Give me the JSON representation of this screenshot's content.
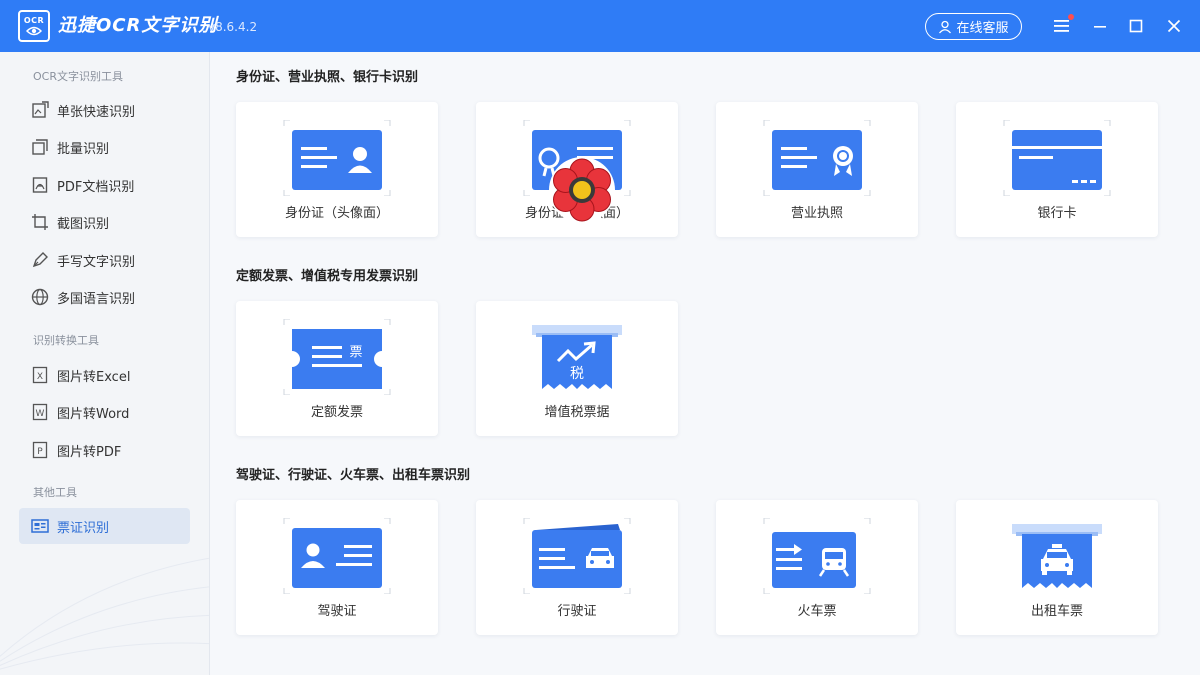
{
  "app": {
    "logo_text": "OCR",
    "title": "迅捷OCR文字识别",
    "version": "v8.6.4.2",
    "service_label": "在线客服"
  },
  "colors": {
    "primary": "#2f7cf6",
    "accent_blue": "#3b7cf0",
    "active_bg": "#dfe7f3"
  },
  "sidebar": {
    "sections": [
      {
        "title": "OCR文字识别工具",
        "items": [
          {
            "label": "单张快速识别",
            "icon": "single-image-icon"
          },
          {
            "label": "批量识别",
            "icon": "batch-icon"
          },
          {
            "label": "PDF文档识别",
            "icon": "pdf-icon"
          },
          {
            "label": "截图识别",
            "icon": "crop-icon"
          },
          {
            "label": "手写文字识别",
            "icon": "pen-icon"
          },
          {
            "label": "多国语言识别",
            "icon": "globe-icon"
          }
        ]
      },
      {
        "title": "识别转换工具",
        "items": [
          {
            "label": "图片转Excel",
            "icon": "excel-icon",
            "letter": "X"
          },
          {
            "label": "图片转Word",
            "icon": "word-icon",
            "letter": "W"
          },
          {
            "label": "图片转PDF",
            "icon": "pdf-file-icon",
            "letter": "P"
          }
        ]
      },
      {
        "title": "其他工具",
        "items": [
          {
            "label": "票证识别",
            "icon": "ticket-icon",
            "active": true
          }
        ]
      }
    ]
  },
  "main": {
    "sections": [
      {
        "title": "身份证、营业执照、银行卡识别",
        "cards": [
          {
            "label": "身份证（头像面）",
            "icon": "id-card-front-icon"
          },
          {
            "label": "身份证（国徽面）",
            "icon": "id-card-back-icon"
          },
          {
            "label": "营业执照",
            "icon": "business-license-icon"
          },
          {
            "label": "银行卡",
            "icon": "bank-card-icon"
          }
        ]
      },
      {
        "title": "定额发票、增值税专用发票识别",
        "cards": [
          {
            "label": "定额发票",
            "icon": "fixed-invoice-icon",
            "glyph": "票"
          },
          {
            "label": "增值税票据",
            "icon": "vat-invoice-icon",
            "glyph": "税"
          }
        ]
      },
      {
        "title": "驾驶证、行驶证、火车票、出租车票识别",
        "cards": [
          {
            "label": "驾驶证",
            "icon": "driver-license-icon"
          },
          {
            "label": "行驶证",
            "icon": "vehicle-license-icon"
          },
          {
            "label": "火车票",
            "icon": "train-ticket-icon"
          },
          {
            "label": "出租车票",
            "icon": "taxi-ticket-icon"
          }
        ]
      }
    ]
  }
}
